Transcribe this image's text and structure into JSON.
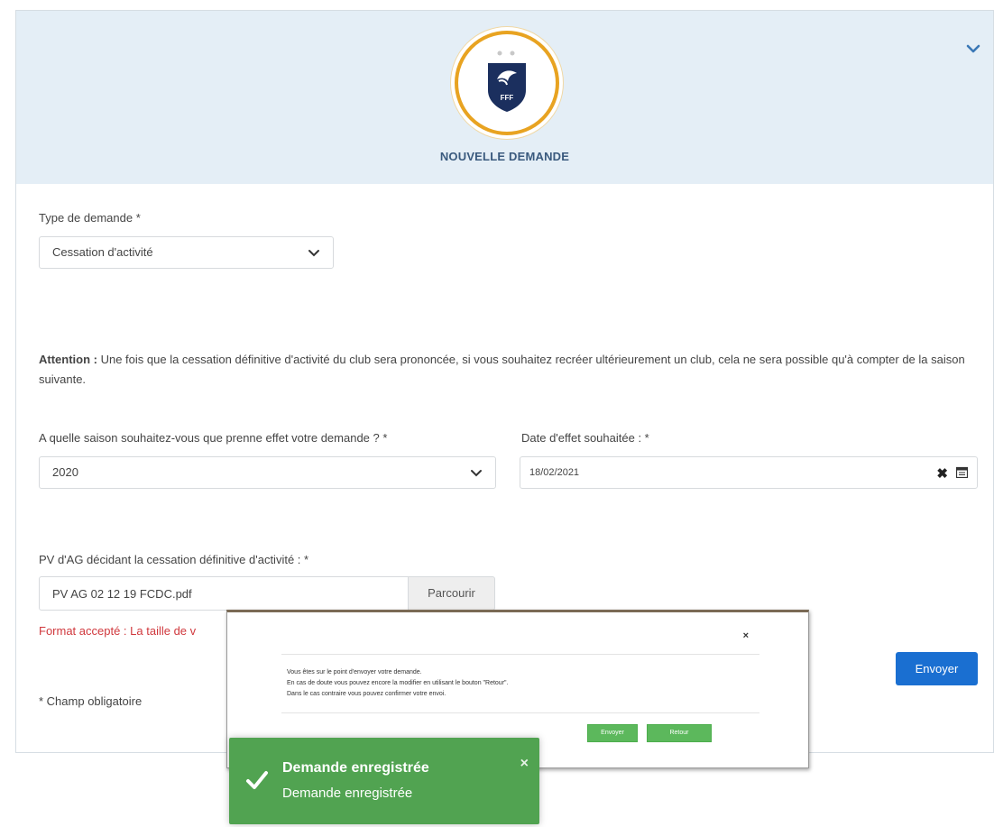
{
  "header": {
    "title": "NOUVELLE DEMANDE",
    "logo_text": "FFF"
  },
  "form": {
    "type_label": "Type de demande *",
    "type_value": "Cessation d'activité",
    "attention_label": "Attention :",
    "attention_text": " Une fois que la cessation définitive d'activité du club sera prononcée, si vous souhaitez recréer ultérieurement un club, cela ne sera possible qu'à compter de la saison suivante.",
    "season_label": "A quelle saison souhaitez-vous que prenne effet votre demande ? *",
    "season_value": "2020",
    "date_label": "Date d'effet souhaitée : *",
    "date_value": "18/02/2021",
    "pv_label": "PV d'AG décidant la cessation définitive d'activité : *",
    "file_value": "PV AG 02 12 19 FCDC.pdf",
    "browse_label": "Parcourir",
    "format_text": "Format accepté : La taille de v",
    "send_label": "Envoyer",
    "required_note": "* Champ obligatoire"
  },
  "modal": {
    "close": "×",
    "line1": "Vous êtes sur le point d'envoyer votre demande.",
    "line2": "En cas de doute vous pouvez encore la modifier en utilisant le bouton \"Retour\".",
    "line3": "Dans le cas contraire vous pouvez confirmer votre envoi.",
    "ok_label": "Envoyer",
    "back_label": "Retour"
  },
  "toast": {
    "title": "Demande enregistrée",
    "message": "Demande enregistrée",
    "close": "×"
  },
  "colors": {
    "header_bg": "#e4eef6",
    "logo_ring": "#e8a321",
    "primary_button": "#1a6fd1",
    "success": "#51a351",
    "error_text": "#d0383d"
  }
}
